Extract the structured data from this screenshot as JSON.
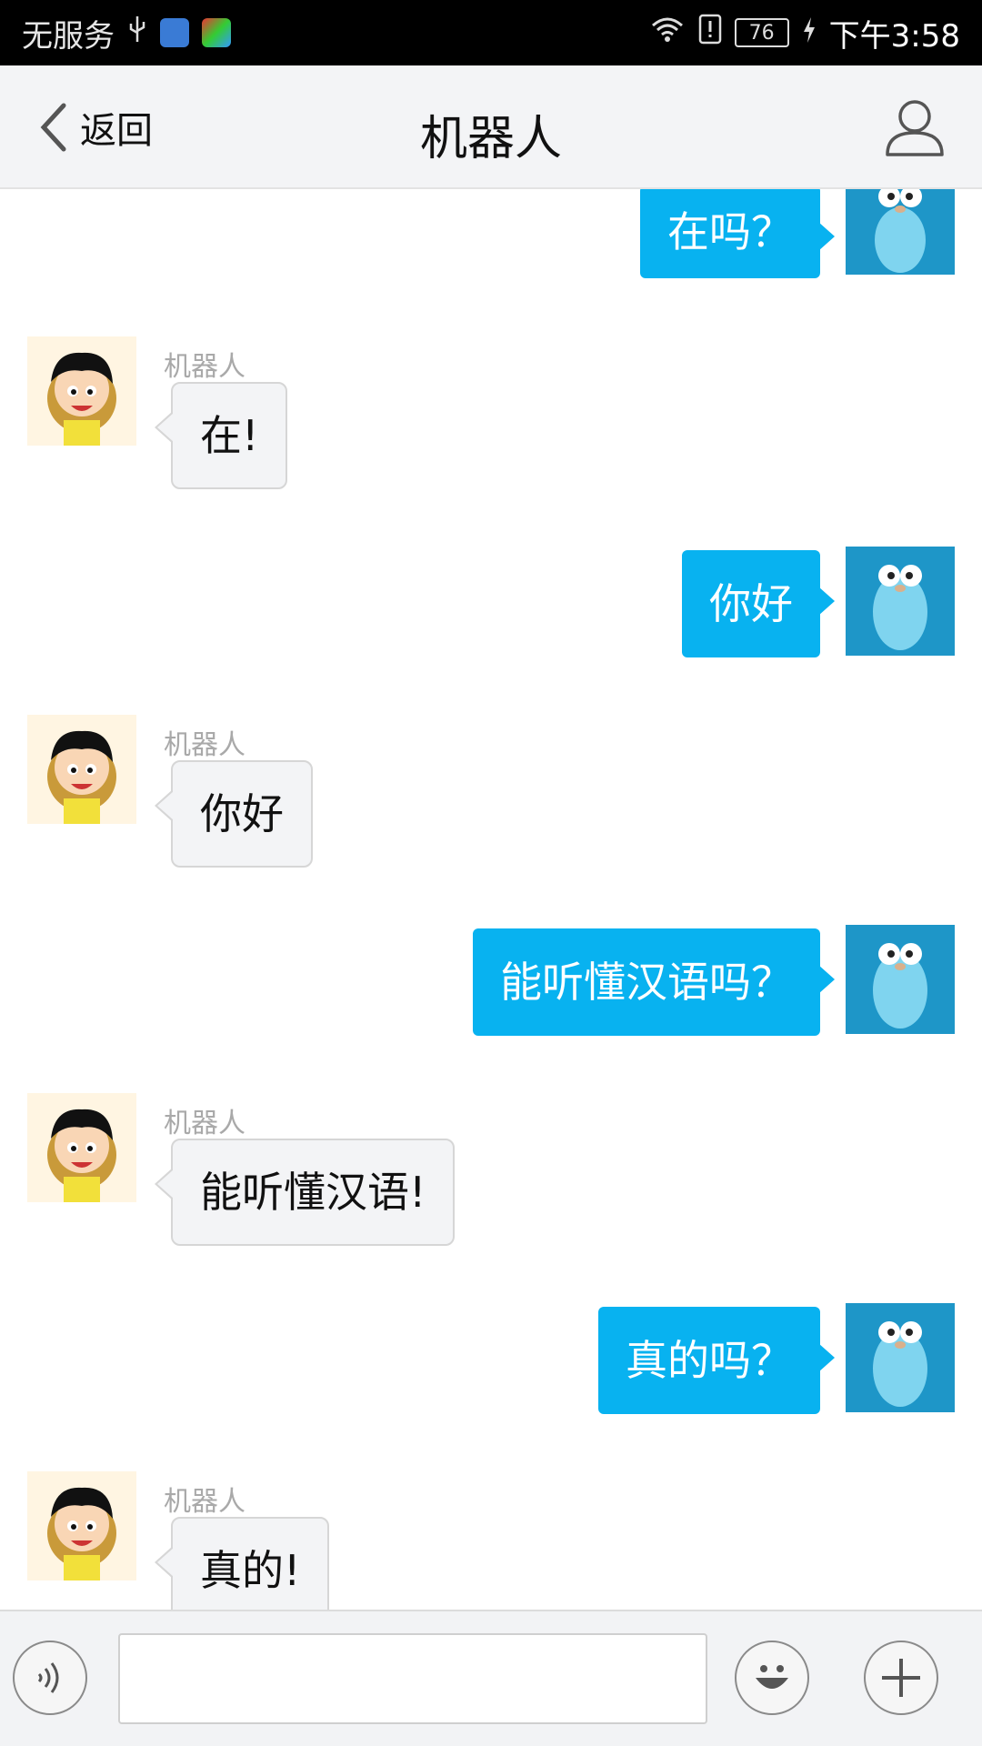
{
  "status_bar": {
    "carrier": "无服务",
    "battery": "76",
    "time": "下午3:58"
  },
  "header": {
    "back_label": "返回",
    "title": "机器人"
  },
  "messages": [
    {
      "from": "me",
      "text": "在吗？"
    },
    {
      "from": "bot",
      "sender": "机器人",
      "text": "在!"
    },
    {
      "from": "me",
      "text": "你好"
    },
    {
      "from": "bot",
      "sender": "机器人",
      "text": "你好"
    },
    {
      "from": "me",
      "text": "能听懂汉语吗？"
    },
    {
      "from": "bot",
      "sender": "机器人",
      "text": "能听懂汉语!"
    },
    {
      "from": "me",
      "text": "真的吗？"
    },
    {
      "from": "bot",
      "sender": "机器人",
      "text": "真的!"
    }
  ],
  "input": {
    "value": "",
    "placeholder": ""
  },
  "colors": {
    "my_bubble": "#08b2f0",
    "bot_bubble": "#f3f4f6",
    "header_bg": "#f3f4f6"
  },
  "icons": [
    "back-chevron-icon",
    "user-profile-icon",
    "voice-icon",
    "emoji-icon",
    "plus-icon"
  ]
}
